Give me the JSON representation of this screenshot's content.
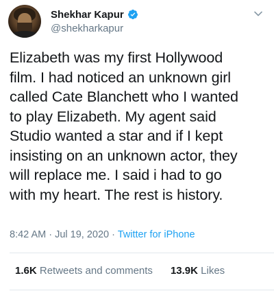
{
  "header": {
    "name": "Shekhar Kapur",
    "handle": "@shekharkapur"
  },
  "tweet": {
    "text": "Elizabeth was my first Hollywood\nfilm. I had noticed an unknown girl\ncalled Cate Blanchett who I wanted\nto play Elizabeth. My agent said\nStudio wanted a star and if I kept\ninsisting on an unknown actor, they\nwill replace me. I said i had to go\nwith my heart. The rest is history."
  },
  "meta": {
    "timestamp": "8:42 AM · Jul 19, 2020",
    "separator": " · ",
    "source": "Twitter for iPhone"
  },
  "stats": {
    "retweets_count": "1.6K",
    "retweets_label": "Retweets and comments",
    "likes_count": "13.9K",
    "likes_label": "Likes"
  },
  "colors": {
    "accent": "#1da1f2",
    "secondary_text": "#657786",
    "primary_text": "#14171a"
  },
  "icons": [
    "verified-badge-icon",
    "chevron-down-icon"
  ]
}
